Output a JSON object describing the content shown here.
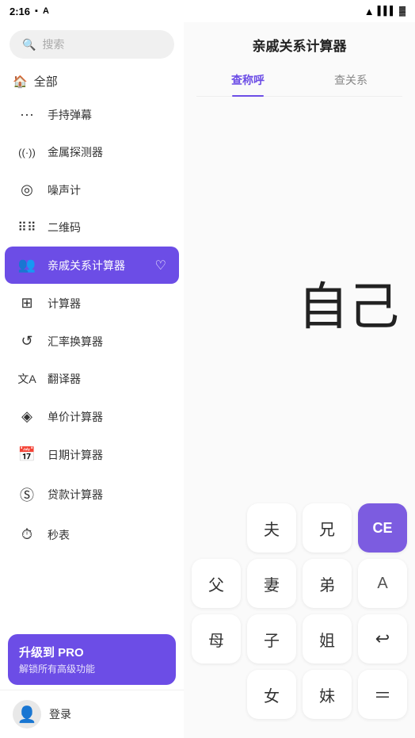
{
  "statusBar": {
    "time": "2:16",
    "wifiIcon": "wifi",
    "signalIcon": "signal",
    "batteryIcon": "battery"
  },
  "sidebar": {
    "searchPlaceholder": "搜索",
    "sectionLabel": "全部",
    "menuItems": [
      {
        "id": "bubble",
        "icon": "···",
        "label": "手持弹幕",
        "active": false
      },
      {
        "id": "metal",
        "icon": "((·))",
        "label": "金属探测器",
        "active": false
      },
      {
        "id": "noise",
        "icon": "◎",
        "label": "噪声计",
        "active": false
      },
      {
        "id": "qrcode",
        "icon": "⠿",
        "label": "二维码",
        "active": false
      },
      {
        "id": "relation",
        "icon": "👥",
        "label": "亲戚关系计算器",
        "active": true,
        "favorite": true
      },
      {
        "id": "calculator",
        "icon": "⊞",
        "label": "计算器",
        "active": false
      },
      {
        "id": "currency",
        "icon": "↺",
        "label": "汇率换算器",
        "active": false
      },
      {
        "id": "translate",
        "icon": "文A",
        "label": "翻译器",
        "active": false
      },
      {
        "id": "unitprice",
        "icon": "◈",
        "label": "单价计算器",
        "active": false
      },
      {
        "id": "date",
        "icon": "📅",
        "label": "日期计算器",
        "active": false
      },
      {
        "id": "loan",
        "icon": "Ⓢ",
        "label": "贷款计算器",
        "active": false
      },
      {
        "id": "stopwatch",
        "icon": "⏱",
        "label": "秒表",
        "active": false
      }
    ],
    "proBanner": {
      "title": "升级到 PRO",
      "subtitle": "解锁所有高级功能"
    },
    "loginLabel": "登录"
  },
  "rightPanel": {
    "title": "亲戚关系计算器",
    "tabs": [
      {
        "id": "query-call",
        "label": "查称呼",
        "active": true
      },
      {
        "id": "query-relation",
        "label": "查关系",
        "active": false
      }
    ],
    "display": {
      "value": "自己"
    },
    "keypad": {
      "rows": [
        [
          {
            "id": "fu",
            "label": "夫",
            "type": "normal"
          },
          {
            "id": "xiong",
            "label": "兄",
            "type": "normal"
          },
          {
            "id": "ce",
            "label": "CE",
            "type": "ce"
          }
        ],
        [
          {
            "id": "fu2",
            "label": "父",
            "type": "normal"
          },
          {
            "id": "qi",
            "label": "妻",
            "type": "normal"
          },
          {
            "id": "di",
            "label": "弟",
            "type": "normal"
          },
          {
            "id": "a",
            "label": "A",
            "type": "special"
          }
        ],
        [
          {
            "id": "mu",
            "label": "母",
            "type": "normal"
          },
          {
            "id": "zi",
            "label": "子",
            "type": "normal"
          },
          {
            "id": "jie",
            "label": "姐",
            "type": "normal"
          },
          {
            "id": "back",
            "label": "↩",
            "type": "arrow"
          }
        ],
        [
          {
            "id": "nv",
            "label": "女",
            "type": "normal"
          },
          {
            "id": "mei",
            "label": "妹",
            "type": "normal"
          },
          {
            "id": "equals",
            "label": "＝",
            "type": "equals"
          }
        ]
      ]
    }
  }
}
